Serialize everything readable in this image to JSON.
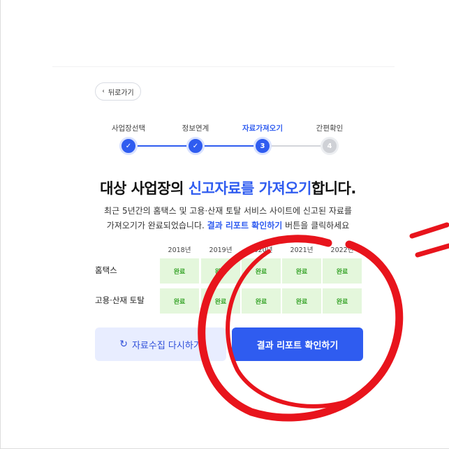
{
  "back_button": {
    "label": "뒤로가기"
  },
  "steps": [
    {
      "label": "사업장선택",
      "marker": "✓",
      "state": "done"
    },
    {
      "label": "정보연계",
      "marker": "✓",
      "state": "done"
    },
    {
      "label": "자료가져오기",
      "marker": "3",
      "state": "current"
    },
    {
      "label": "간편확인",
      "marker": "4",
      "state": "todo"
    }
  ],
  "headline": {
    "before": "대상 사업장의 ",
    "highlight": "신고자료를 가져오기",
    "after": "합니다."
  },
  "description": {
    "line1": "최근 5년간의 홈택스 및 고용·산재 토탈 서비스 사이트에 신고된 자료를",
    "line2_before": "가져오기가 완료되었습니다. ",
    "line2_bold": "결과 리포트 확인하기",
    "line2_after": " 버튼을 클릭하세요"
  },
  "table": {
    "years": [
      "2018년",
      "2019년",
      "2020년",
      "2021년",
      "2022년"
    ],
    "rows": [
      {
        "label": "홈택스",
        "cells": [
          "완료",
          "완료",
          "완료",
          "완료",
          "완료"
        ]
      },
      {
        "label": "고용·산재 토탈",
        "cells": [
          "완료",
          "완료",
          "완료",
          "완료",
          "완료"
        ]
      }
    ]
  },
  "buttons": {
    "retry": "자료수집 다시하기",
    "report": "결과 리포트 확인하기"
  },
  "colors": {
    "accent": "#2f5cf0",
    "complete_bg": "#e4f7dc",
    "complete_text": "#3aa52c",
    "annotation": "#e8141c"
  },
  "icons": {
    "back": "chevron-left-icon",
    "step_done": "check-icon",
    "retry": "refresh-icon"
  }
}
